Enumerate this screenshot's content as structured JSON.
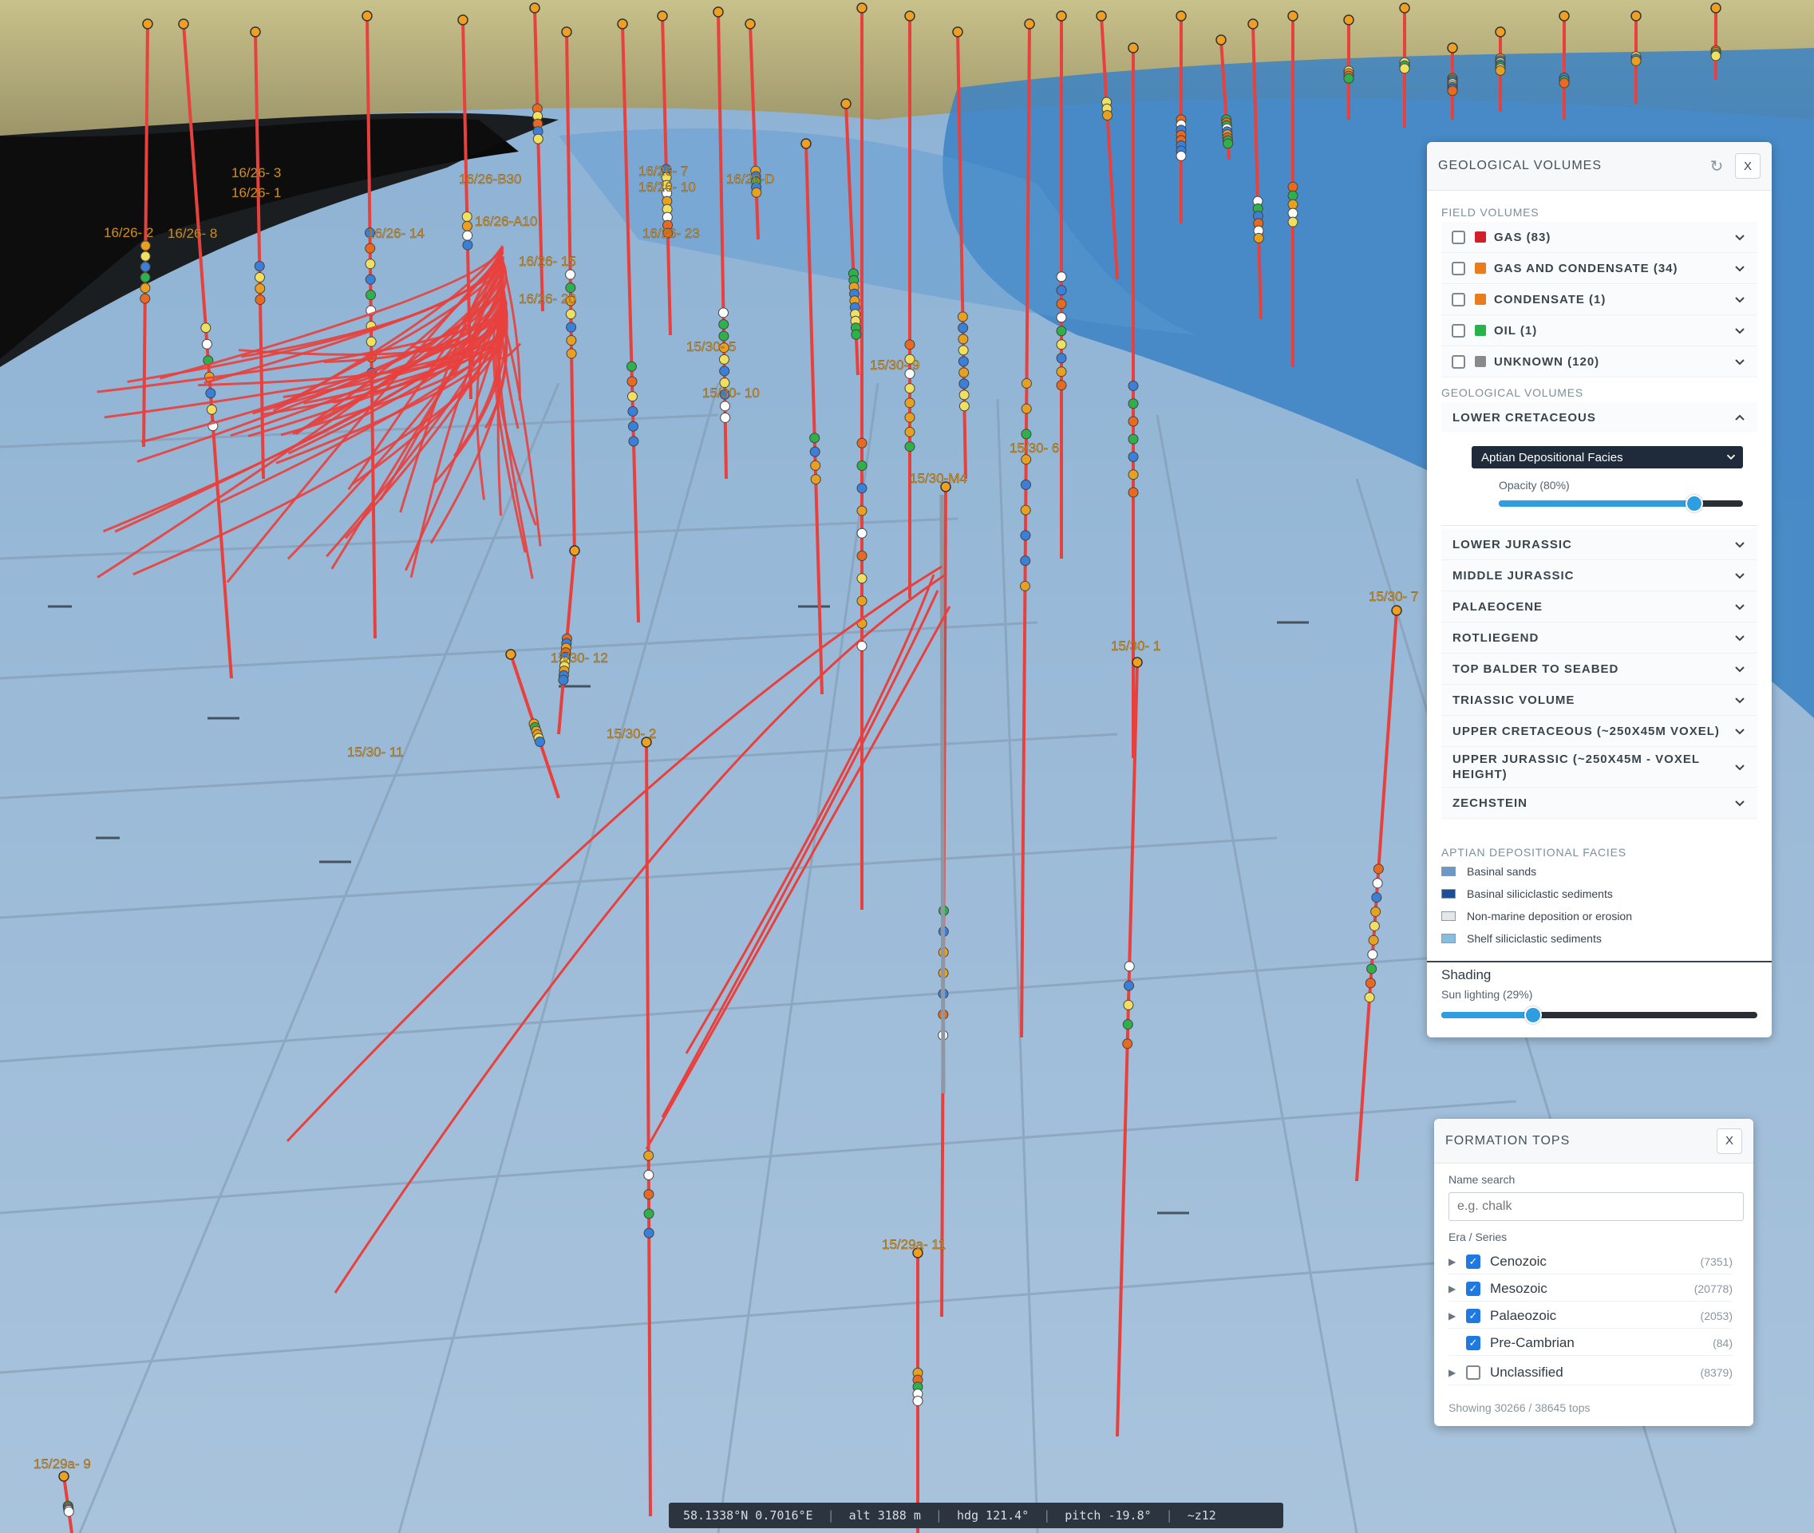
{
  "map": {
    "well_labels": [
      "16/26- 2",
      "16/26- 3",
      "16/26- 1",
      "16/26-B30",
      "16/26-A10",
      "16/26-D",
      "16/26- 7",
      "16/26- 10",
      "16/26- 15",
      "16/26- 14",
      "16/26- 20",
      "16/26- 23",
      "15/30- 5",
      "15/30- 9",
      "15/30- 10",
      "15/30- 6",
      "15/30-M4",
      "15/30- 7",
      "15/30- 1",
      "15/30- 12",
      "15/30- 2",
      "15/30- 11",
      "15/29a- 11",
      "15/29a- 9",
      "16/26- 8"
    ],
    "colors": {
      "well": "#e8403d",
      "water_deep": "#3d86c8",
      "water_shallow": "#a7c3dd",
      "land": "#b8b27e"
    }
  },
  "geo_panel": {
    "title": "GEOLOGICAL VOLUMES",
    "refresh_icon": "refresh-icon",
    "close_label": "X",
    "field_volumes_label": "FIELD VOLUMES",
    "field_volumes": [
      {
        "label": "GAS (83)",
        "color": "#d0202a"
      },
      {
        "label": "GAS AND CONDENSATE (34)",
        "color": "#e87c1e"
      },
      {
        "label": "CONDENSATE (1)",
        "color": "#e87c1e"
      },
      {
        "label": "OIL (1)",
        "color": "#27b34a"
      },
      {
        "label": "UNKNOWN (120)",
        "color": "#8a8a8a"
      }
    ],
    "geological_volumes_label": "GEOLOGICAL VOLUMES",
    "expanded_item": "LOWER CRETACEOUS",
    "dropdown_value": "Aptian Depositional Facies",
    "opacity_label": "Opacity (80%)",
    "opacity_value": 0.8,
    "volumes": [
      "LOWER JURASSIC",
      "MIDDLE JURASSIC",
      "PALAEOCENE",
      "ROTLIEGEND",
      "TOP BALDER TO SEABED",
      "TRIASSIC VOLUME",
      "UPPER CRETACEOUS (~250X45M VOXEL)",
      "UPPER JURASSIC (~250X45M - VOXEL",
      "HEIGHT)",
      "ZECHSTEIN"
    ],
    "legend_title": "APTIAN DEPOSITIONAL FACIES",
    "legend": [
      {
        "label": "Basinal sands",
        "color": "#6a98c8"
      },
      {
        "label": "Basinal siliciclastic sediments",
        "color": "#1e4f95"
      },
      {
        "label": "Non-marine deposition or erosion",
        "color": "#e6e6e6"
      },
      {
        "label": "Shelf siliciclastic sediments",
        "color": "#87bde0"
      }
    ],
    "shading_label": "Shading",
    "sun_label": "Sun lighting (29%)",
    "sun_value": 0.29
  },
  "formation_panel": {
    "title": "FORMATION TOPS",
    "close_label": "X",
    "name_search_label": "Name search",
    "search_placeholder": "e.g. chalk",
    "era_label": "Era / Series",
    "eras": [
      {
        "name": "Cenozoic",
        "count": "(7351)",
        "checked": true,
        "expandable": true
      },
      {
        "name": "Mesozoic",
        "count": "(20778)",
        "checked": true,
        "expandable": true
      },
      {
        "name": "Palaeozoic",
        "count": "(2053)",
        "checked": true,
        "expandable": true
      },
      {
        "name": "Pre-Cambrian",
        "count": "(84)",
        "checked": true,
        "expandable": false
      },
      {
        "name": "Unclassified",
        "count": "(8379)",
        "checked": false,
        "expandable": true
      }
    ],
    "showing": "Showing 30266 / 38645 tops"
  },
  "status_bar": {
    "coords": "58.1338°N 0.7016°E",
    "alt": "alt 3188 m",
    "hdg": "hdg 121.4°",
    "pitch": "pitch -19.8°",
    "zoom": "~z12"
  }
}
